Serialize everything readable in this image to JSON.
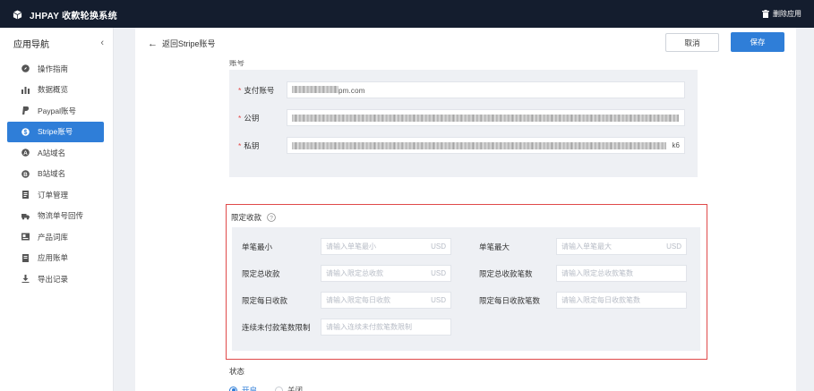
{
  "app": {
    "title": "JHPAY 收款轮换系统",
    "delete_app": "删除应用"
  },
  "sidebar": {
    "heading": "应用导航",
    "items": [
      {
        "label": "操作指南",
        "icon": "compass-icon"
      },
      {
        "label": "数据概览",
        "icon": "bar-chart-icon"
      },
      {
        "label": "Paypal账号",
        "icon": "paypal-icon"
      },
      {
        "label": "Stripe账号",
        "icon": "dollar-icon",
        "active": true
      },
      {
        "label": "A站域名",
        "icon": "letter-a-icon"
      },
      {
        "label": "B站域名",
        "icon": "letter-b-icon"
      },
      {
        "label": "订单管理",
        "icon": "document-icon"
      },
      {
        "label": "物流单号回传",
        "icon": "truck-icon"
      },
      {
        "label": "产品词库",
        "icon": "id-card-icon"
      },
      {
        "label": "应用账单",
        "icon": "bill-icon"
      },
      {
        "label": "导出记录",
        "icon": "download-icon"
      }
    ]
  },
  "toolbar": {
    "back": "返回Stripe账号",
    "cancel": "取消",
    "save": "保存"
  },
  "account": {
    "section_label": "账号",
    "pay_account_label": "支付账号",
    "pay_account_value": "pm.com",
    "public_key_label": "公钥",
    "private_key_label": "私钥",
    "private_key_tail": "k6"
  },
  "limits": {
    "title": "限定收款",
    "fields": [
      {
        "label": "单笔最小",
        "placeholder": "请输入单笔最小",
        "suffix": "USD"
      },
      {
        "label": "单笔最大",
        "placeholder": "请输入单笔最大",
        "suffix": "USD"
      },
      {
        "label": "限定总收款",
        "placeholder": "请输入限定总收款",
        "suffix": "USD"
      },
      {
        "label": "限定总收款笔数",
        "placeholder": "请输入限定总收款笔数",
        "suffix": ""
      },
      {
        "label": "限定每日收款",
        "placeholder": "请输入限定每日收款",
        "suffix": "USD"
      },
      {
        "label": "限定每日收款笔数",
        "placeholder": "请输入限定每日收款笔数",
        "suffix": ""
      },
      {
        "label": "连续未付款笔数限制",
        "placeholder": "请输入连续未付款笔数限制",
        "suffix": ""
      }
    ]
  },
  "status": {
    "label": "状态",
    "options": [
      "开启",
      "关闭"
    ],
    "selected": "开启"
  },
  "colors": {
    "topbar": "#141d2e",
    "accent": "#2f7ed8",
    "highlight_border": "#e04a4a",
    "panel": "#eef0f4"
  }
}
